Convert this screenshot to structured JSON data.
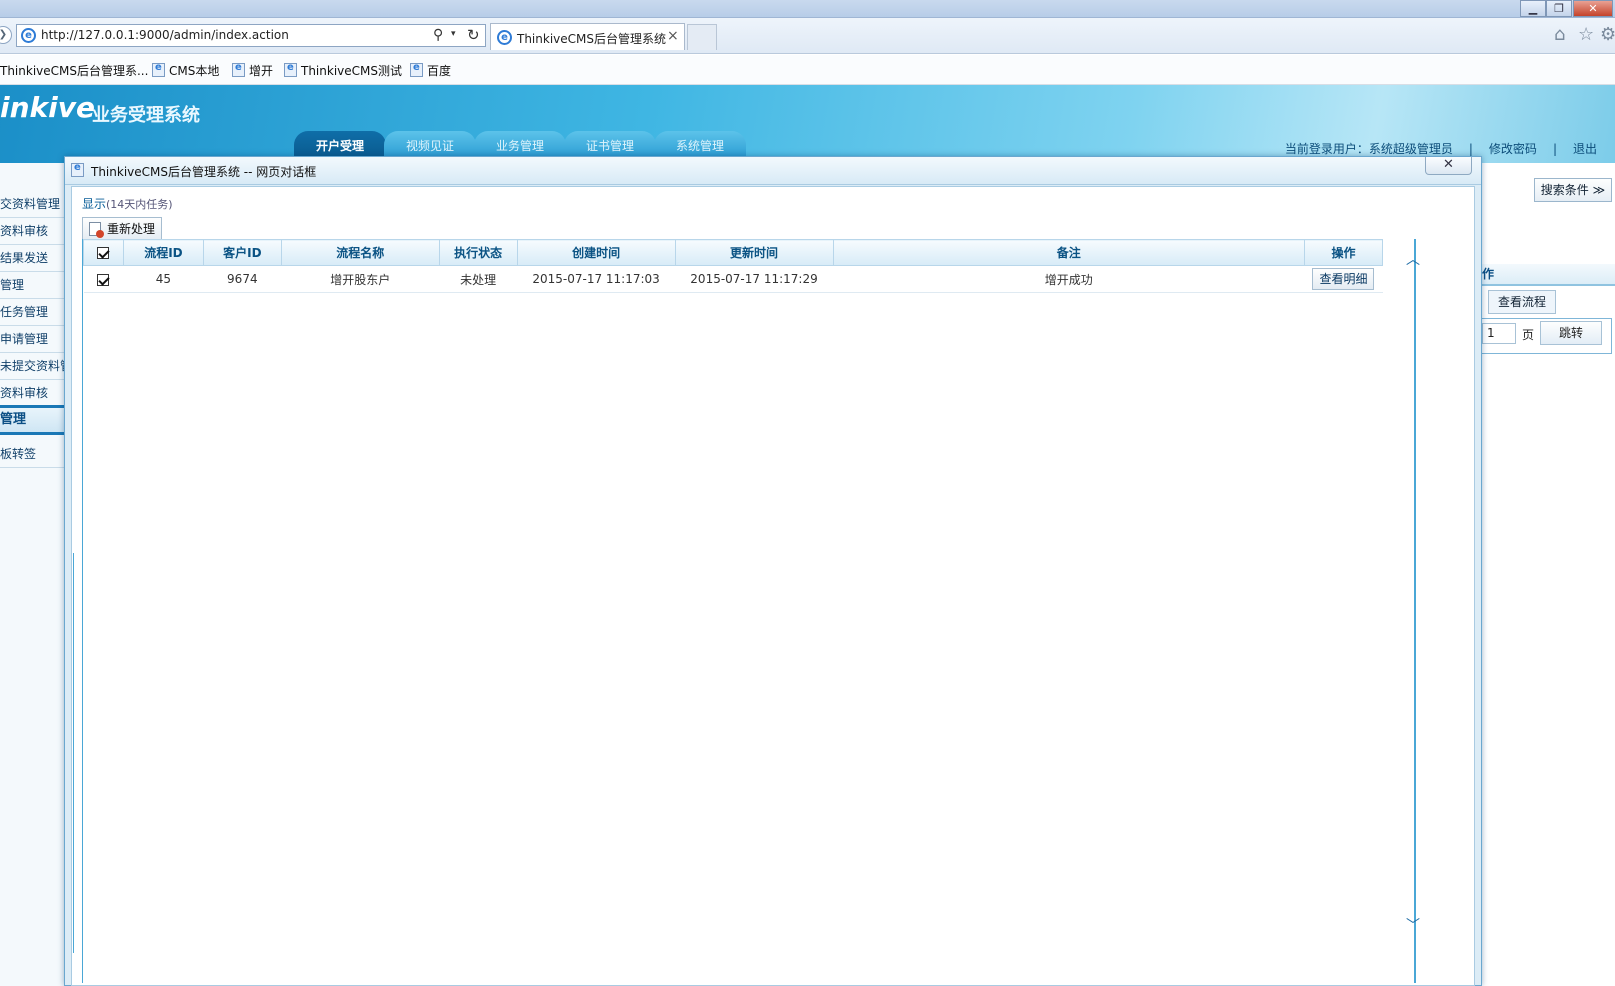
{
  "browser": {
    "window_title": "",
    "address": "http://127.0.0.1:9000/admin/index.action",
    "tab_title": "ThinkiveCMS后台管理系统",
    "tab_close": "×",
    "win_min": "▁",
    "win_max": "❐",
    "win_close": "✕",
    "favorites": [
      "ThinkiveCMS后台管理系...",
      "CMS本地",
      "增开",
      "ThinkiveCMS测试",
      "百度"
    ]
  },
  "app": {
    "logo": "inkive",
    "system_name": "业务受理系统",
    "tabs": [
      "开户受理",
      "视频见证",
      "业务管理",
      "证书管理",
      "系统管理"
    ],
    "active_tab": 0,
    "user_label": "当前登录用户：系统超级管理员",
    "change_password": "修改密码",
    "separator": "|",
    "logout": "退出"
  },
  "sidebar": {
    "items": [
      "交资料管理",
      "资料审核",
      "结果发送",
      "管理",
      "任务管理",
      "申请管理",
      "未提交资料管",
      "资料审核"
    ],
    "section": "管理",
    "after_section": [
      "板转签"
    ]
  },
  "right_panel": {
    "search_conditions": "搜索条件 ≫",
    "header": "作",
    "view_flow": "查看流程",
    "page_value": "1",
    "page_unit": "页",
    "jump": "跳转"
  },
  "dialog": {
    "title": "ThinkiveCMS后台管理系统 -- 网页对话框",
    "close": "✕",
    "show_label": "显示",
    "show_hint": "(14天内任务)",
    "reprocess": "重新处理",
    "columns": [
      "流程ID",
      "客户ID",
      "流程名称",
      "执行状态",
      "创建时间",
      "更新时间",
      "备注",
      "操作"
    ],
    "rows": [
      {
        "flow_id": "45",
        "customer_id": "9674",
        "flow_name": "增开股东户",
        "status": "未处理",
        "created": "2015-07-17 11:17:03",
        "updated": "2015-07-17 11:17:29",
        "remark": "增开成功",
        "action": "查看明细"
      }
    ]
  },
  "colors": {
    "header_blue": "#1b8fc8",
    "active_tab": "#0a5a8e",
    "table_header_text": "#0b5384",
    "border_blue": "#4aa7d6"
  }
}
